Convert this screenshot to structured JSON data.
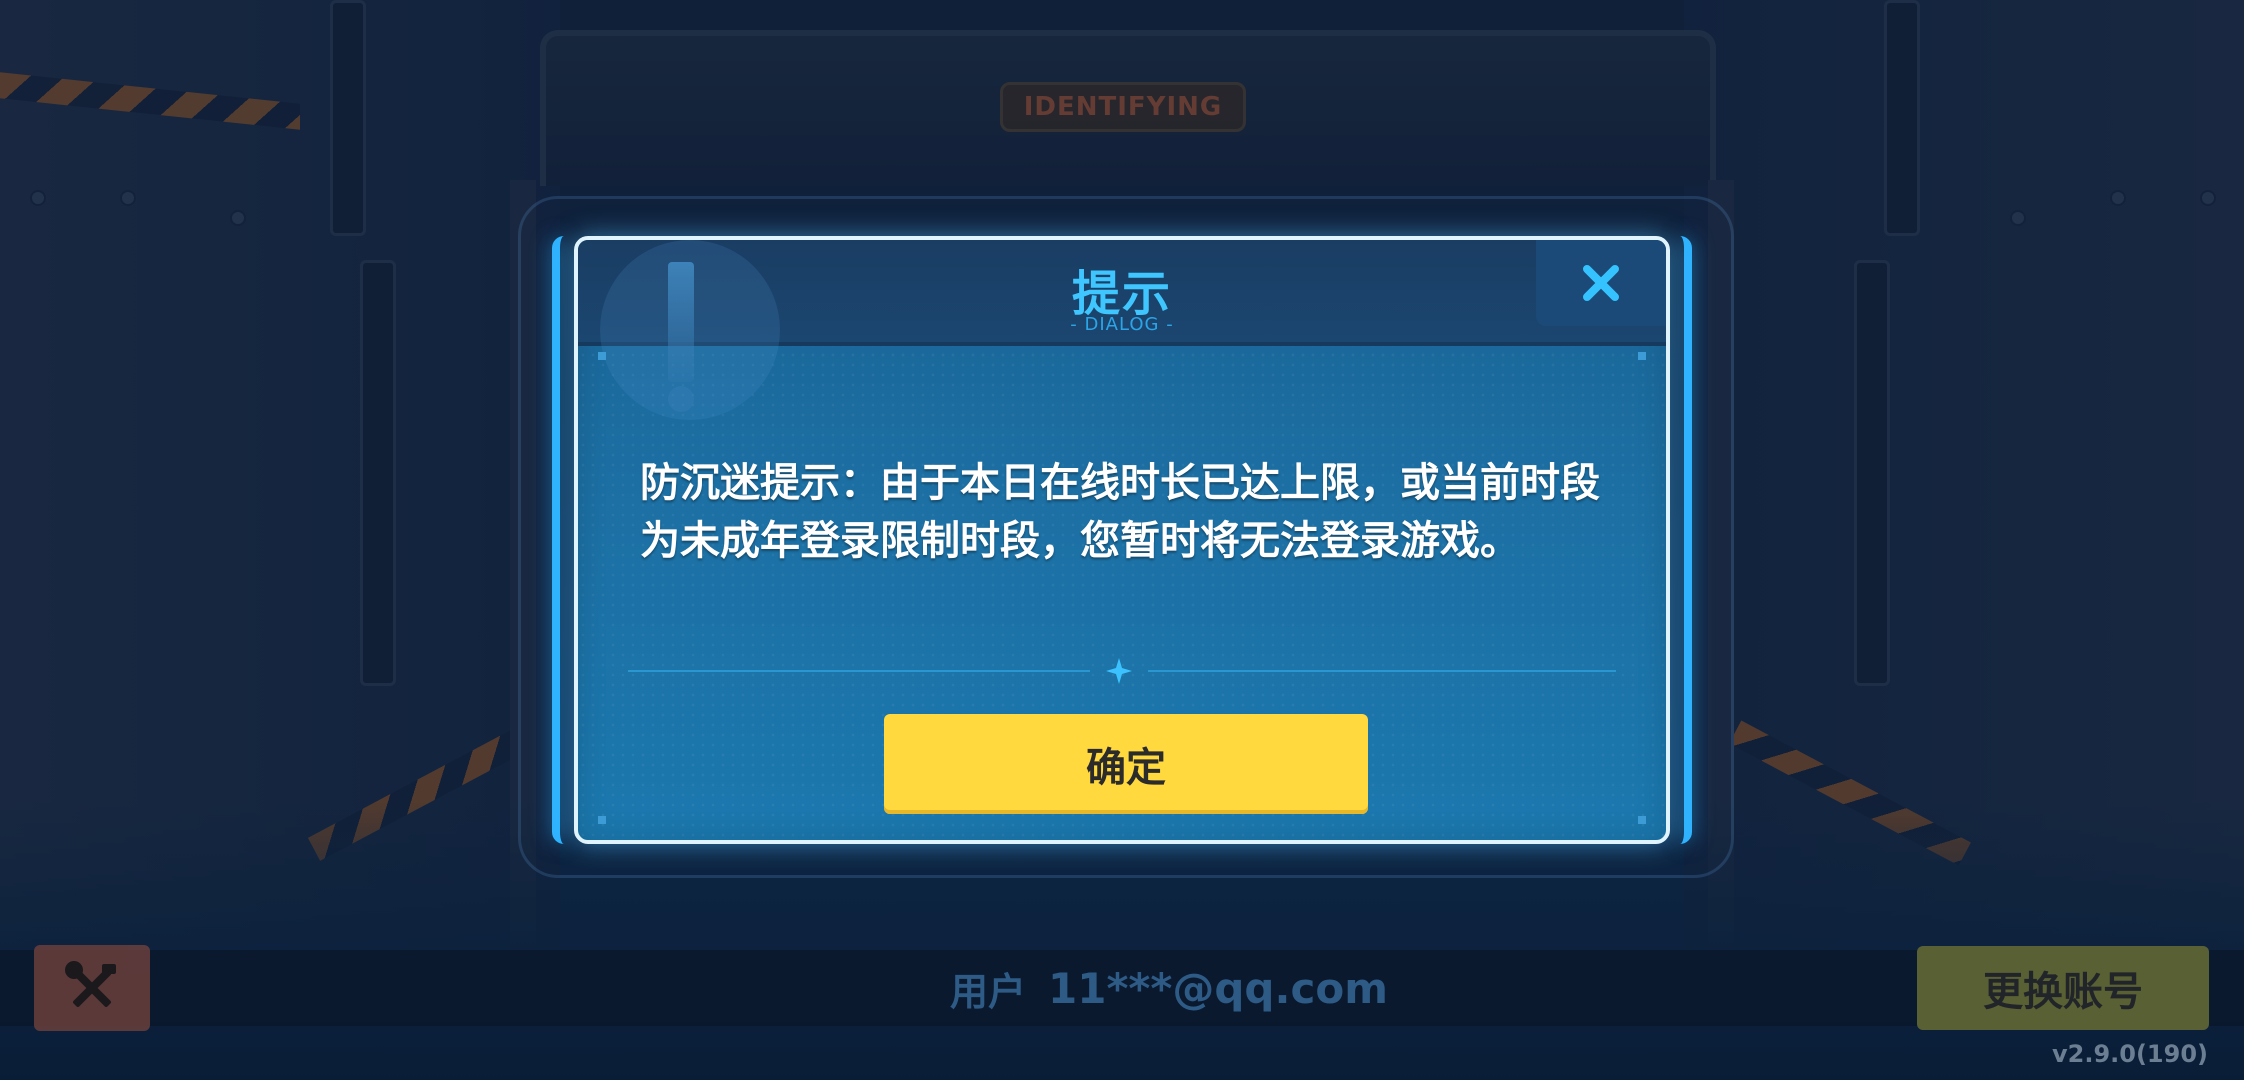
{
  "background": {
    "sign_text": "IDENTIFYING"
  },
  "dialog": {
    "title": "提示",
    "subtitle": "- DIALOG -",
    "message": "防沉迷提示：由于本日在线时长已达上限，或当前时段为未成年登录限制时段，您暂时将无法登录游戏。",
    "confirm_label": "确定",
    "close_icon": "close-icon"
  },
  "footer": {
    "tools_icon": "tools-icon",
    "user_prefix": "用户",
    "user_email": "11***@qq.com",
    "switch_account_label": "更换账号",
    "version": "v2.9.0(190)"
  },
  "colors": {
    "dialog_title": "#3fc6ff",
    "confirm_button": "#ffd93d",
    "dialog_border": "#2fb3ff"
  }
}
